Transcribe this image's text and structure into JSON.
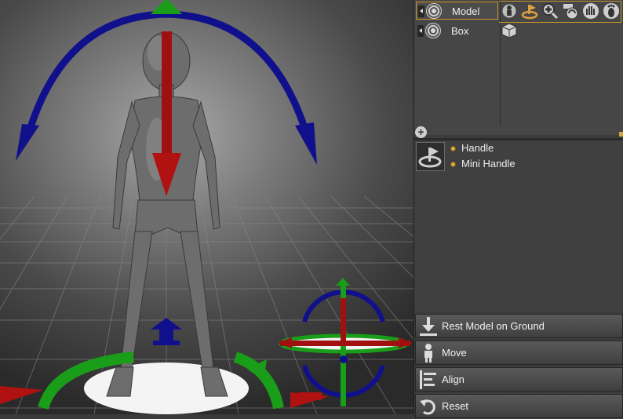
{
  "scene": {
    "objects": [
      {
        "label": "Model",
        "selected": true,
        "tools": [
          "person-gizmo-icon",
          "handle-tool-icon",
          "zoom-tool-icon",
          "rotate-view-icon",
          "hand-icon",
          "foot-icon"
        ]
      },
      {
        "label": "Box",
        "selected": false,
        "tools": [
          "cube-icon"
        ]
      }
    ]
  },
  "handles": {
    "options": [
      {
        "label": "Handle"
      },
      {
        "label": "Mini Handle"
      }
    ]
  },
  "actions": [
    {
      "label": "Rest Model on Ground",
      "icon": "rest-on-ground-icon"
    },
    {
      "label": "Move",
      "icon": "move-icon"
    },
    {
      "label": "Align",
      "icon": "align-icon"
    },
    {
      "label": "Reset",
      "icon": "reset-icon"
    }
  ],
  "colors": {
    "accent": "#c8962a",
    "gizmo_x": "#c01818",
    "gizmo_y": "#1a9e1a",
    "gizmo_z": "#10108c"
  }
}
